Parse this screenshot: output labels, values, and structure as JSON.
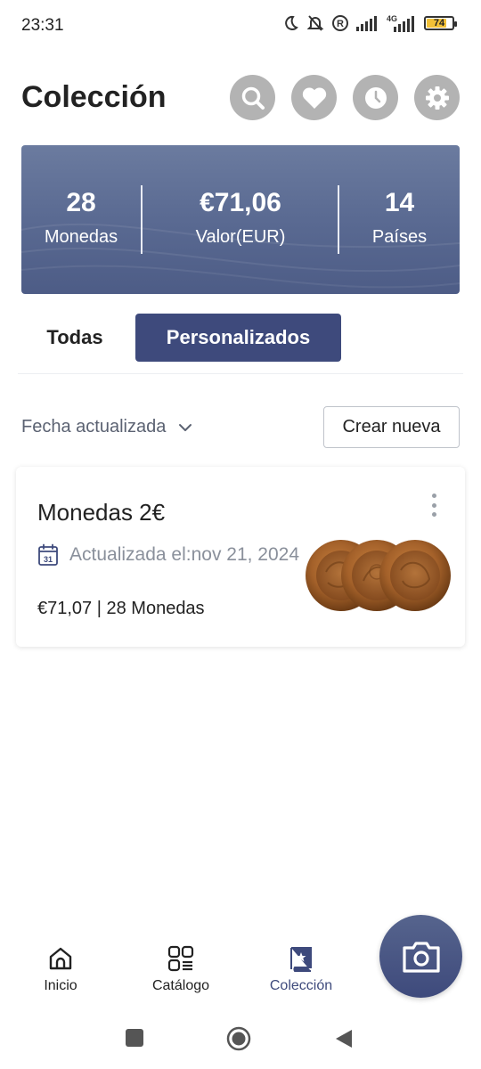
{
  "status_bar": {
    "time": "23:31",
    "battery": "74",
    "network": "4G"
  },
  "header": {
    "title": "Colección",
    "actions": [
      "search-icon",
      "heart-icon",
      "clock-icon",
      "gear-icon"
    ]
  },
  "stats": [
    {
      "value": "28",
      "label": "Monedas"
    },
    {
      "value": "€71,06",
      "label": "Valor(EUR)"
    },
    {
      "value": "14",
      "label": "Países"
    }
  ],
  "tabs": {
    "all": "Todas",
    "custom": "Personalizados",
    "active": "custom"
  },
  "sort": {
    "label": "Fecha actualizada",
    "create_label": "Crear nueva"
  },
  "collections": [
    {
      "title": "Monedas 2€",
      "updated": "Actualizada el:nov 21, 2024",
      "calendar_day": "31",
      "summary": "€71,07 | 28 Monedas"
    }
  ],
  "bottom_nav": [
    {
      "label": "Inicio",
      "icon": "home-icon"
    },
    {
      "label": "Catálogo",
      "icon": "catalog-icon"
    },
    {
      "label": "Colección",
      "icon": "collection-icon",
      "active": true
    }
  ],
  "colors": {
    "accent": "#3e4a7c",
    "card_bg": "#5a6a92",
    "icon_btn": "#b3b3b3"
  }
}
